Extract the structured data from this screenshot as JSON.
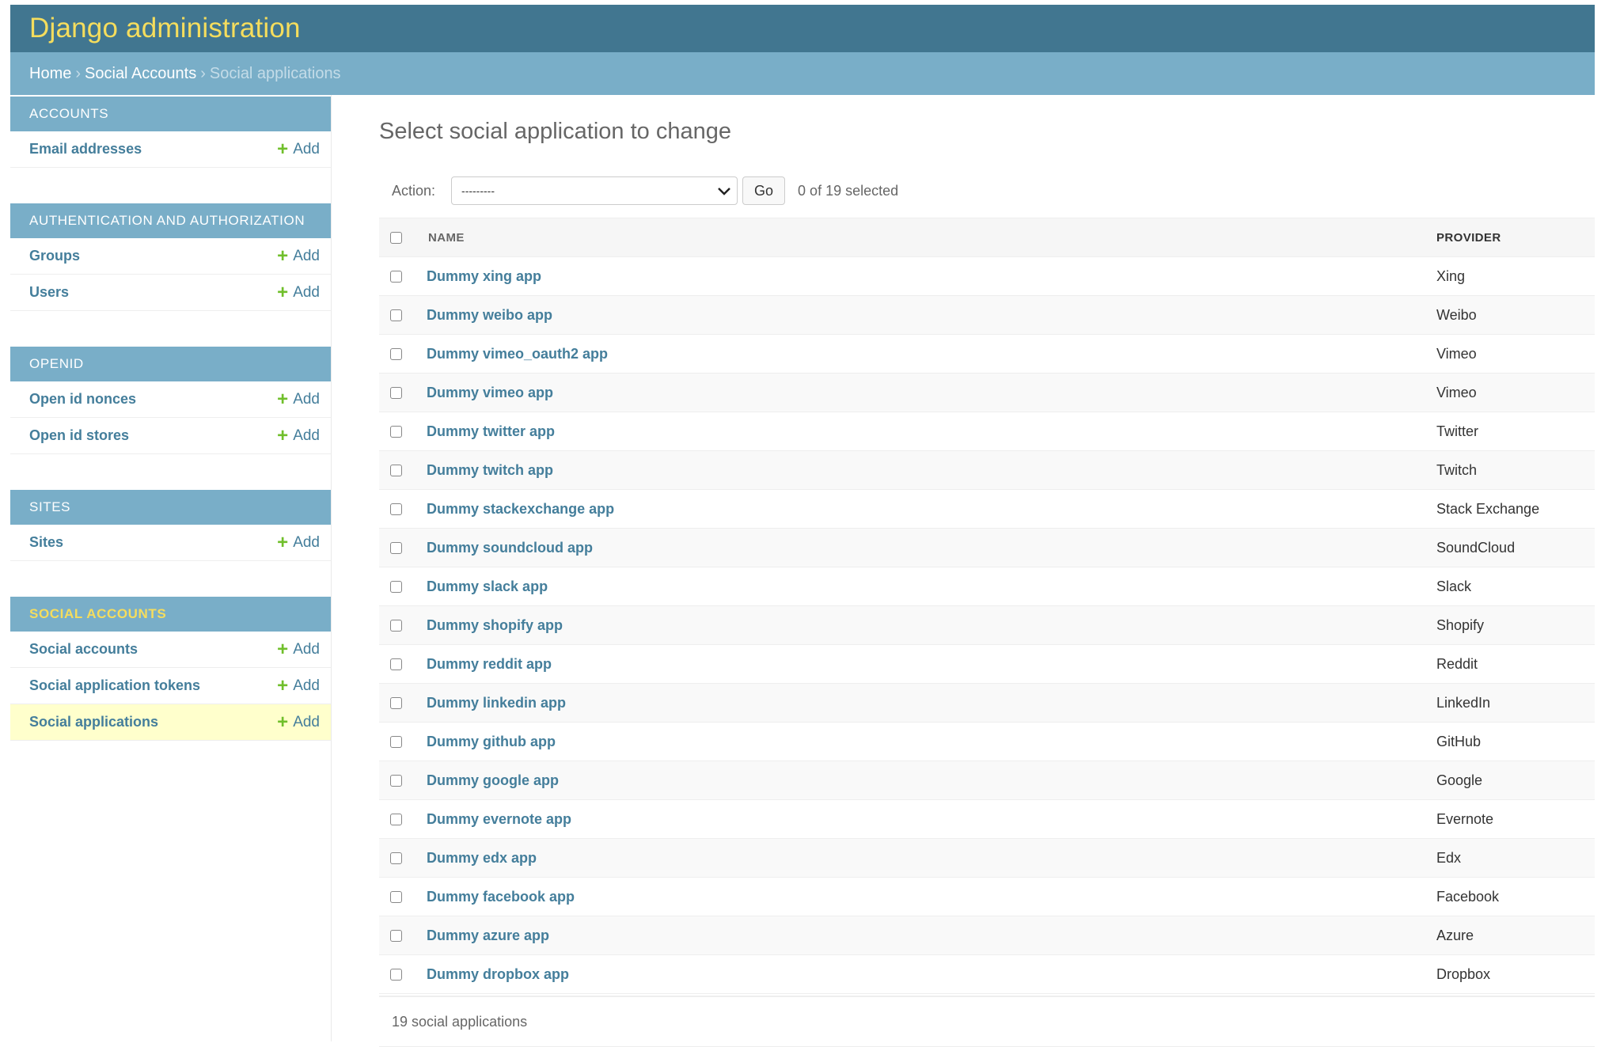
{
  "header": {
    "site_title": "Django administration"
  },
  "breadcrumbs": {
    "home": "Home",
    "section": "Social Accounts",
    "current": "Social applications",
    "separator": "›"
  },
  "sidebar": {
    "add_label": "Add",
    "modules": [
      {
        "caption": "ACCOUNTS",
        "selected": false,
        "models": [
          {
            "name": "Email addresses"
          }
        ]
      },
      {
        "caption": "AUTHENTICATION AND AUTHORIZATION",
        "selected": false,
        "models": [
          {
            "name": "Groups"
          },
          {
            "name": "Users"
          }
        ]
      },
      {
        "caption": "OPENID",
        "selected": false,
        "models": [
          {
            "name": "Open id nonces"
          },
          {
            "name": "Open id stores"
          }
        ]
      },
      {
        "caption": "SITES",
        "selected": false,
        "models": [
          {
            "name": "Sites"
          }
        ]
      },
      {
        "caption": "SOCIAL ACCOUNTS",
        "selected": true,
        "models": [
          {
            "name": "Social accounts"
          },
          {
            "name": "Social application tokens"
          },
          {
            "name": "Social applications",
            "current": true
          }
        ]
      }
    ]
  },
  "content": {
    "title": "Select social application to change",
    "action_label": "Action:",
    "action_selected": "---------",
    "go_label": "Go",
    "counter": "0 of 19 selected",
    "columns": {
      "name": "NAME",
      "provider": "PROVIDER"
    },
    "rows": [
      {
        "name": "Dummy xing app",
        "provider": "Xing"
      },
      {
        "name": "Dummy weibo app",
        "provider": "Weibo"
      },
      {
        "name": "Dummy vimeo_oauth2 app",
        "provider": "Vimeo"
      },
      {
        "name": "Dummy vimeo app",
        "provider": "Vimeo"
      },
      {
        "name": "Dummy twitter app",
        "provider": "Twitter"
      },
      {
        "name": "Dummy twitch app",
        "provider": "Twitch"
      },
      {
        "name": "Dummy stackexchange app",
        "provider": "Stack Exchange"
      },
      {
        "name": "Dummy soundcloud app",
        "provider": "SoundCloud"
      },
      {
        "name": "Dummy slack app",
        "provider": "Slack"
      },
      {
        "name": "Dummy shopify app",
        "provider": "Shopify"
      },
      {
        "name": "Dummy reddit app",
        "provider": "Reddit"
      },
      {
        "name": "Dummy linkedin app",
        "provider": "LinkedIn"
      },
      {
        "name": "Dummy github app",
        "provider": "GitHub"
      },
      {
        "name": "Dummy google app",
        "provider": "Google"
      },
      {
        "name": "Dummy evernote app",
        "provider": "Evernote"
      },
      {
        "name": "Dummy edx app",
        "provider": "Edx"
      },
      {
        "name": "Dummy facebook app",
        "provider": "Facebook"
      },
      {
        "name": "Dummy azure app",
        "provider": "Azure"
      },
      {
        "name": "Dummy dropbox app",
        "provider": "Dropbox"
      }
    ],
    "paginator": "19 social applications"
  },
  "colors": {
    "header": "#417690",
    "breadcrumbs": "#79aec8",
    "title_yellow": "#f5dd5d",
    "link": "#447e9b",
    "add_green": "#70bf2b",
    "current_row": "#ffffcc"
  }
}
